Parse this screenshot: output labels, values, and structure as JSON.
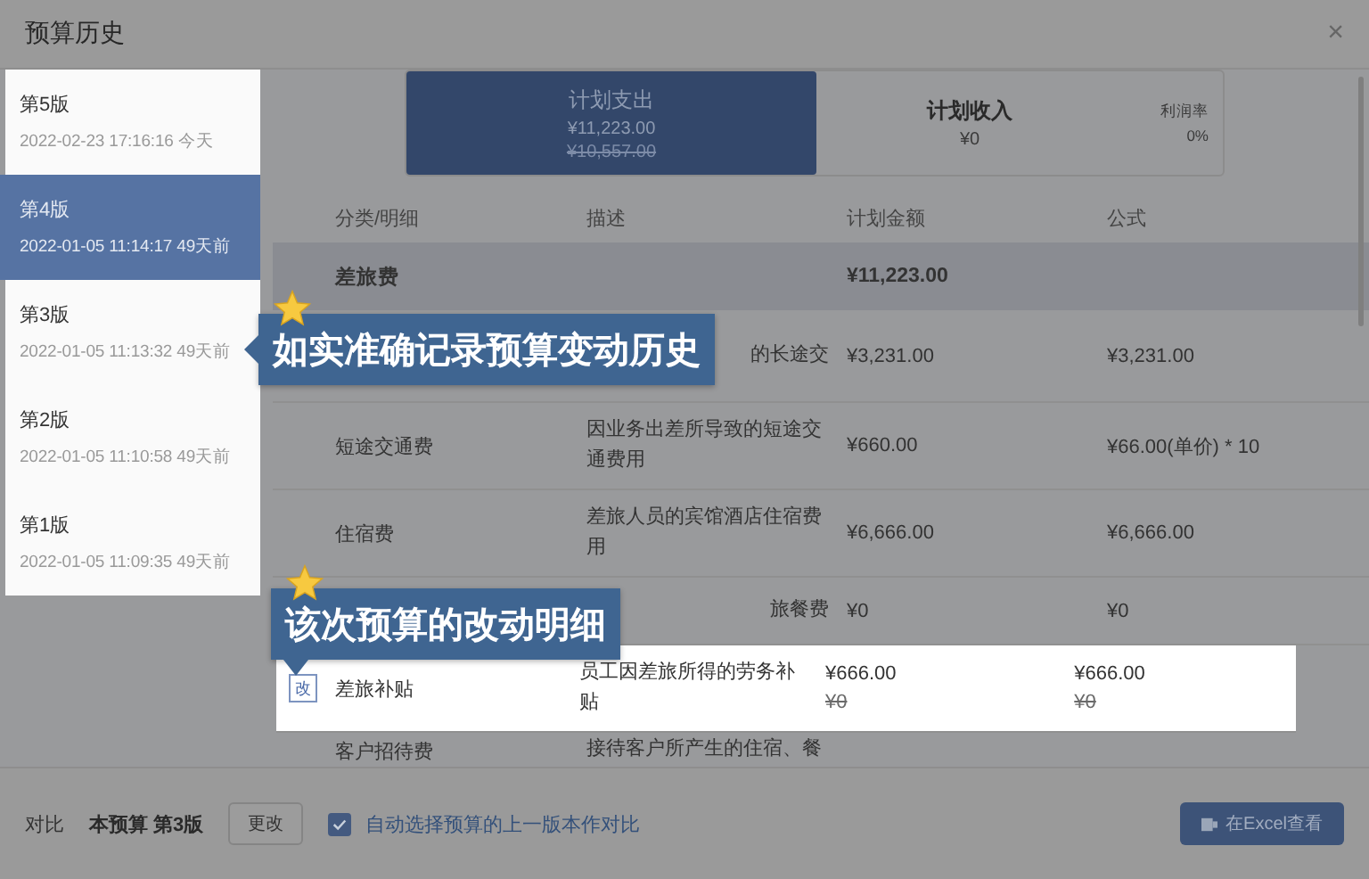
{
  "dialog": {
    "title": "预算历史",
    "close": "×"
  },
  "versions": [
    {
      "label": "第5版",
      "time": "2022-02-23 17:16:16 今天",
      "selected": false
    },
    {
      "label": "第4版",
      "time": "2022-01-05 11:14:17 49天前",
      "selected": true
    },
    {
      "label": "第3版",
      "time": "2022-01-05 11:13:32 49天前",
      "selected": false
    },
    {
      "label": "第2版",
      "time": "2022-01-05 11:10:58 49天前",
      "selected": false
    },
    {
      "label": "第1版",
      "time": "2022-01-05 11:09:35 49天前",
      "selected": false
    }
  ],
  "summary": {
    "expense": {
      "label": "计划支出",
      "value": "¥11,223.00",
      "previous": "¥10,557.00",
      "selected": true
    },
    "income": {
      "label": "计划收入",
      "value": "¥0",
      "selected": false
    },
    "margin": {
      "label": "利润率",
      "value": "0%"
    }
  },
  "table": {
    "columns": [
      "分类/明细",
      "描述",
      "计划金额",
      "公式"
    ],
    "rows": [
      {
        "kind": "group",
        "category": "差旅费",
        "amount": "¥11,223.00"
      },
      {
        "kind": "item",
        "description": "的长途交",
        "amount": "¥3,231.00",
        "formula": "¥3,231.00"
      },
      {
        "kind": "item",
        "category": "短途交通费",
        "description": "因业务出差所导致的短途交通费用",
        "amount": "¥660.00",
        "formula": "¥66.00(单价) * 10"
      },
      {
        "kind": "item",
        "category": "住宿费",
        "description": "差旅人员的宾馆酒店住宿费用",
        "amount": "¥6,666.00",
        "formula": "¥6,666.00"
      },
      {
        "kind": "item",
        "description": "旅餐费",
        "amount": "¥0",
        "formula": "¥0"
      },
      {
        "kind": "item",
        "highlighted": true,
        "badge": "改",
        "category": "差旅补贴",
        "description": "员工因差旅所得的劳务补贴",
        "amount": "¥666.00",
        "previous_amount": "¥0",
        "formula": "¥666.00",
        "previous_formula": "¥0"
      },
      {
        "kind": "item",
        "category": "客户招待费",
        "description": "接待客户所产生的住宿、餐"
      }
    ]
  },
  "footer": {
    "compare_label": "对比",
    "current": "本预算 第3版",
    "change_button": "更改",
    "auto_select": {
      "label": "自动选择预算的上一版本作对比",
      "checked": true
    },
    "excel_button": "在Excel查看"
  },
  "callouts": [
    {
      "text": "如实准确记录预算变动历史"
    },
    {
      "text": "该次预算的改动明细"
    }
  ]
}
